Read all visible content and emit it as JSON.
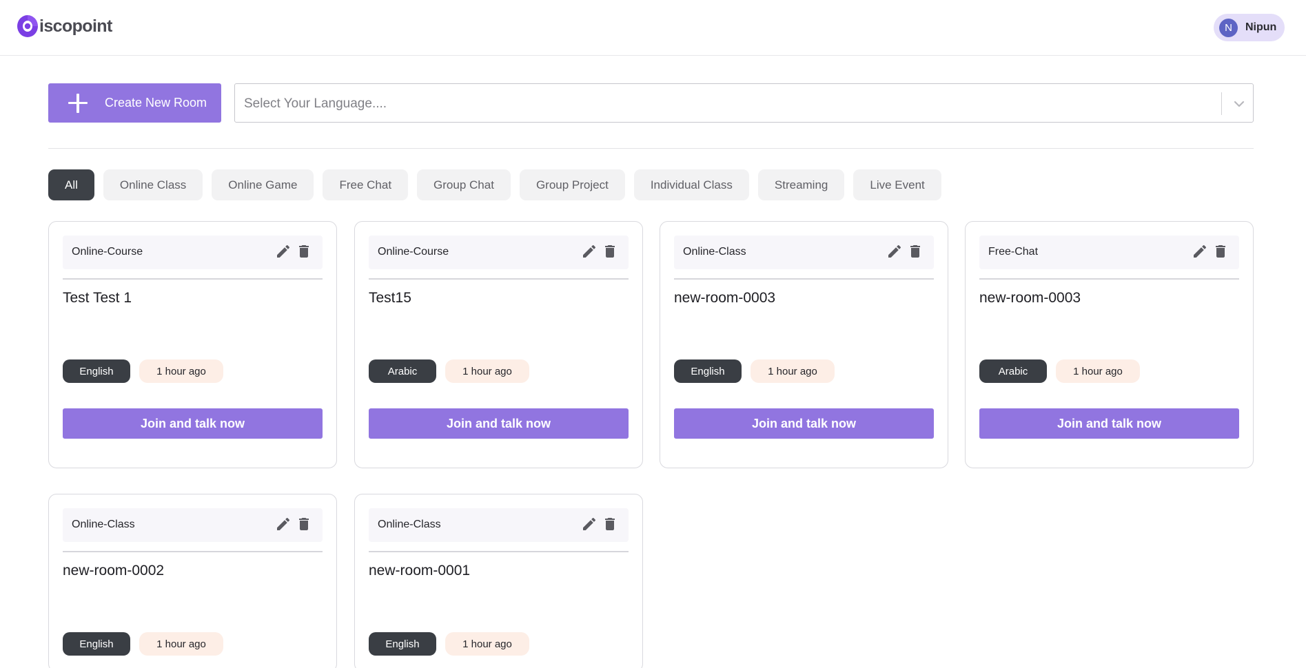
{
  "header": {
    "logo_text": "iscopoint",
    "user": {
      "initial": "N",
      "name": "Nipun"
    }
  },
  "controls": {
    "create_label": "Create New Room",
    "language_placeholder": "Select Your Language...."
  },
  "filters": [
    {
      "label": "All",
      "active": true
    },
    {
      "label": "Online Class",
      "active": false
    },
    {
      "label": "Online Game",
      "active": false
    },
    {
      "label": "Free Chat",
      "active": false
    },
    {
      "label": "Group Chat",
      "active": false
    },
    {
      "label": "Group Project",
      "active": false
    },
    {
      "label": "Individual Class",
      "active": false
    },
    {
      "label": "Streaming",
      "active": false
    },
    {
      "label": "Live Event",
      "active": false
    }
  ],
  "rooms": [
    {
      "type": "Online-Course",
      "title": "Test Test 1",
      "language": "English",
      "time": "1 hour ago",
      "join_label": "Join and talk now"
    },
    {
      "type": "Online-Course",
      "title": "Test15",
      "language": "Arabic",
      "time": "1 hour ago",
      "join_label": "Join and talk now"
    },
    {
      "type": "Online-Class",
      "title": "new-room-0003",
      "language": "English",
      "time": "1 hour ago",
      "join_label": "Join and talk now"
    },
    {
      "type": "Free-Chat",
      "title": "new-room-0003",
      "language": "Arabic",
      "time": "1 hour ago",
      "join_label": "Join and talk now"
    },
    {
      "type": "Online-Class",
      "title": "new-room-0002",
      "language": "English",
      "time": "1 hour ago",
      "join_label": "Join and talk now"
    },
    {
      "type": "Online-Class",
      "title": "new-room-0001",
      "language": "English",
      "time": "1 hour ago",
      "join_label": "Join and talk now"
    }
  ],
  "colors": {
    "brand": "#9175e0",
    "logo": "#7b3fe4",
    "dark_chip": "#3d4147",
    "time_badge": "#fdeee6"
  },
  "icons": [
    "logo-c-icon",
    "plus-icon",
    "chevron-down-icon",
    "edit-icon",
    "trash-icon"
  ]
}
